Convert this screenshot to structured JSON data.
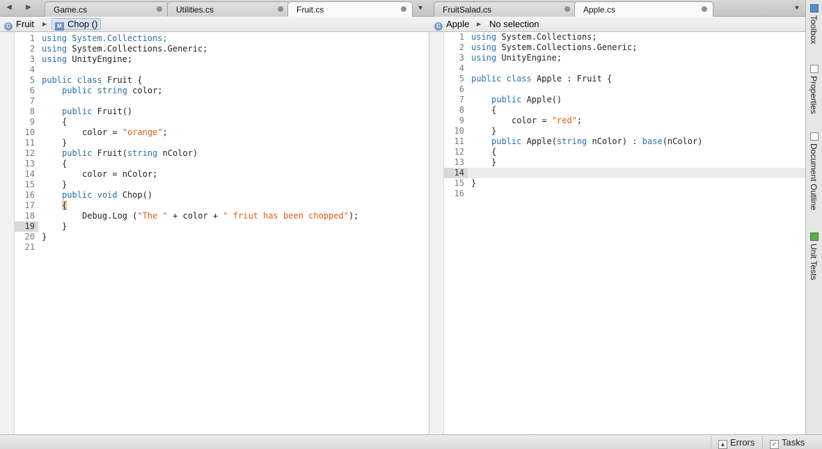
{
  "left_pane": {
    "tabs": [
      {
        "label": "Game.cs",
        "active": false
      },
      {
        "label": "Utilities.cs",
        "active": false
      },
      {
        "label": "Fruit.cs",
        "active": true
      }
    ],
    "breadcrumb": {
      "class_name": "Fruit",
      "method_name": "Chop ()",
      "method_icon_letter": "M"
    },
    "highlighted_line": "19",
    "code_lines": [
      {
        "n": "1"
      },
      {
        "n": "2"
      },
      {
        "n": "3"
      },
      {
        "n": "4"
      },
      {
        "n": "5"
      },
      {
        "n": "6"
      },
      {
        "n": "7"
      },
      {
        "n": "8"
      },
      {
        "n": "9"
      },
      {
        "n": "10"
      },
      {
        "n": "11"
      },
      {
        "n": "12"
      },
      {
        "n": "13"
      },
      {
        "n": "14"
      },
      {
        "n": "15"
      },
      {
        "n": "16"
      },
      {
        "n": "17"
      },
      {
        "n": "18"
      },
      {
        "n": "19"
      },
      {
        "n": "20"
      },
      {
        "n": "21"
      }
    ],
    "code": {
      "l1": "using System.Collections;",
      "l2": "using System.Collections.Generic;",
      "l3": "using UnityEngine;",
      "l5": "public class Fruit {",
      "l6": "public string color;",
      "l8": "public Fruit()",
      "l9": "{",
      "l10a": "color = ",
      "l10b": "\"orange\"",
      "l10c": ";",
      "l11": "}",
      "l12": "public Fruit(string nColor)",
      "l13": "{",
      "l14": "color = nColor;",
      "l15": "}",
      "l16": "public void Chop()",
      "l17": "{",
      "l18a": "Debug.Log (",
      "l18b": "\"The \"",
      "l18c": " + color + ",
      "l18d": "\" friut has been chopped\"",
      "l18e": ");",
      "l19": "}",
      "l20": "}"
    }
  },
  "right_pane": {
    "tabs": [
      {
        "label": "FruitSalad.cs",
        "active": false
      },
      {
        "label": "Apple.cs",
        "active": true
      }
    ],
    "breadcrumb": {
      "class_name": "Apple",
      "selection": "No selection"
    },
    "highlighted_line": "14",
    "code": {
      "l1": "using System.Collections;",
      "l2": "using System.Collections.Generic;",
      "l3": "using UnityEngine;",
      "l5": "public class Apple : Fruit {",
      "l7": "public Apple()",
      "l8": "{",
      "l9a": "color = ",
      "l9b": "\"red\"",
      "l9c": ";",
      "l10": "}",
      "l11": "public Apple(string nColor) : base(nColor)",
      "l12": "{",
      "l13": "}",
      "l15": "}"
    }
  },
  "side_panel": {
    "items": [
      "Toolbox",
      "Properties",
      "Document Outline",
      "Unit Tests"
    ]
  },
  "status_bar": {
    "errors_label": "Errors",
    "tasks_label": "Tasks"
  },
  "colors": {
    "keyword": "#2a6eb0",
    "string": "#e05e12",
    "line_number": "#7a7a7a"
  }
}
